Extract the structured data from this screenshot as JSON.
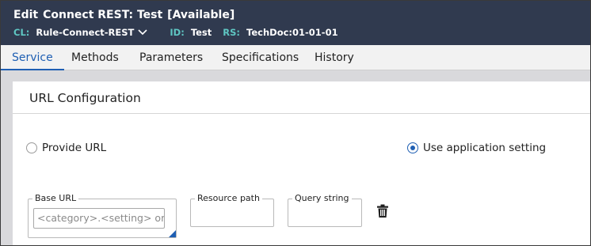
{
  "header": {
    "edit_label": "Edit",
    "rule_title": "Connect REST: Test",
    "status": "[Available]",
    "cl_key": "CL:",
    "cl_value": "Rule-Connect-REST",
    "id_key": "ID:",
    "id_value": "Test",
    "rs_key": "RS:",
    "rs_value": "TechDoc:01-01-01"
  },
  "tabs": [
    {
      "label": "Service",
      "active": true
    },
    {
      "label": "Methods",
      "active": false
    },
    {
      "label": "Parameters",
      "active": false
    },
    {
      "label": "Specifications",
      "active": false
    },
    {
      "label": "History",
      "active": false
    }
  ],
  "section": {
    "title": "URL Configuration",
    "radio_provide_url": "Provide URL",
    "radio_use_app_setting": "Use application setting",
    "selected": "Use application setting"
  },
  "fields": {
    "base_url_label": "Base URL",
    "base_url_placeholder": "<category>.<setting> or",
    "resource_path_label": "Resource path",
    "query_string_label": "Query string"
  },
  "icons": {
    "cl_dropdown": "chevron-down-icon",
    "delete": "trash-icon"
  },
  "colors": {
    "header_bg": "#303a4f",
    "key_accent": "#5fc7c3",
    "active_tab": "#1f5fb3"
  }
}
